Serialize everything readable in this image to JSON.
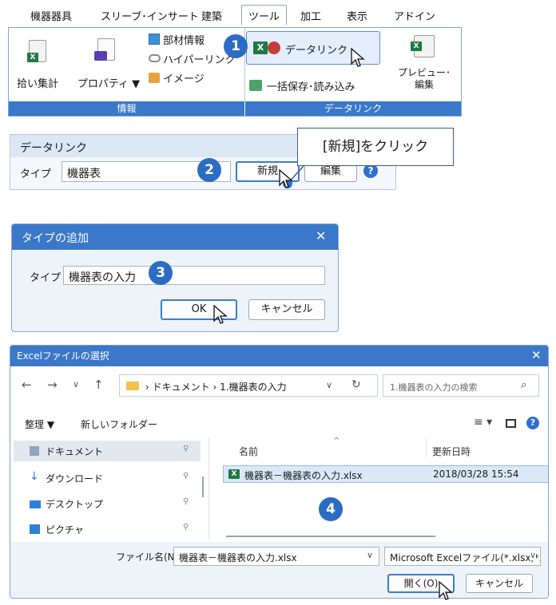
{
  "menu": {
    "tabs": [
      "機器器具",
      "スリーブ･インサート",
      "建築",
      "ツール",
      "加工",
      "表示",
      "アドイン"
    ],
    "active_tab": "ツール"
  },
  "ribbon": {
    "btn_tally": "拾い集計",
    "btn_properties": "プロパティ ▼",
    "btn_component_info": "部材情報",
    "btn_hyperlink": "ハイパーリンク",
    "btn_image": "イメージ",
    "group_info": "情報",
    "btn_data_link": "データリンク",
    "btn_bulk_save": "一括保存･読み込み",
    "btn_preview_l1": "プレビュー･",
    "btn_preview_l2": "編集",
    "group_data_link": "データリンク"
  },
  "steps": [
    "1",
    "2",
    "3",
    "4"
  ],
  "datalink_panel": {
    "title": "データリンク",
    "type_label": "タイプ",
    "type_value": "機器表",
    "btn_new": "新規",
    "btn_edit": "編集",
    "callout": "[新規]をクリック"
  },
  "add_type_dialog": {
    "title": "タイプの追加",
    "type_label": "タイプ",
    "type_value": "機器表の入力",
    "btn_ok": "OK",
    "btn_cancel": "キャンセル"
  },
  "file_dialog": {
    "title": "Excelファイルの選択",
    "breadcrumb_1": "ドキュメント",
    "breadcrumb_sep": "›",
    "breadcrumb_2": "1.機器表の入力",
    "search_placeholder": "1.機器表の入力の検索",
    "organize": "整理 ▼",
    "new_folder": "新しいフォルダー",
    "nav_items": [
      "ドキュメント",
      "ダウンロード",
      "デスクトップ",
      "ピクチャ"
    ],
    "col_name": "名前",
    "col_modified": "更新日時",
    "file_name": "機器表－機器表の入力.xlsx",
    "file_date": "2018/03/28 15:54",
    "filename_label": "ファイル名(N):",
    "filename_value": "機器表－機器表の入力.xlsx",
    "filter": "Microsoft Excelファイル(*.xlsx;*.x",
    "btn_open": "開く(O)",
    "btn_cancel": "キャンセル"
  },
  "colors": {
    "accent": "#3b78c9",
    "step": "#2b6cc4",
    "excel": "#1d7a45"
  }
}
